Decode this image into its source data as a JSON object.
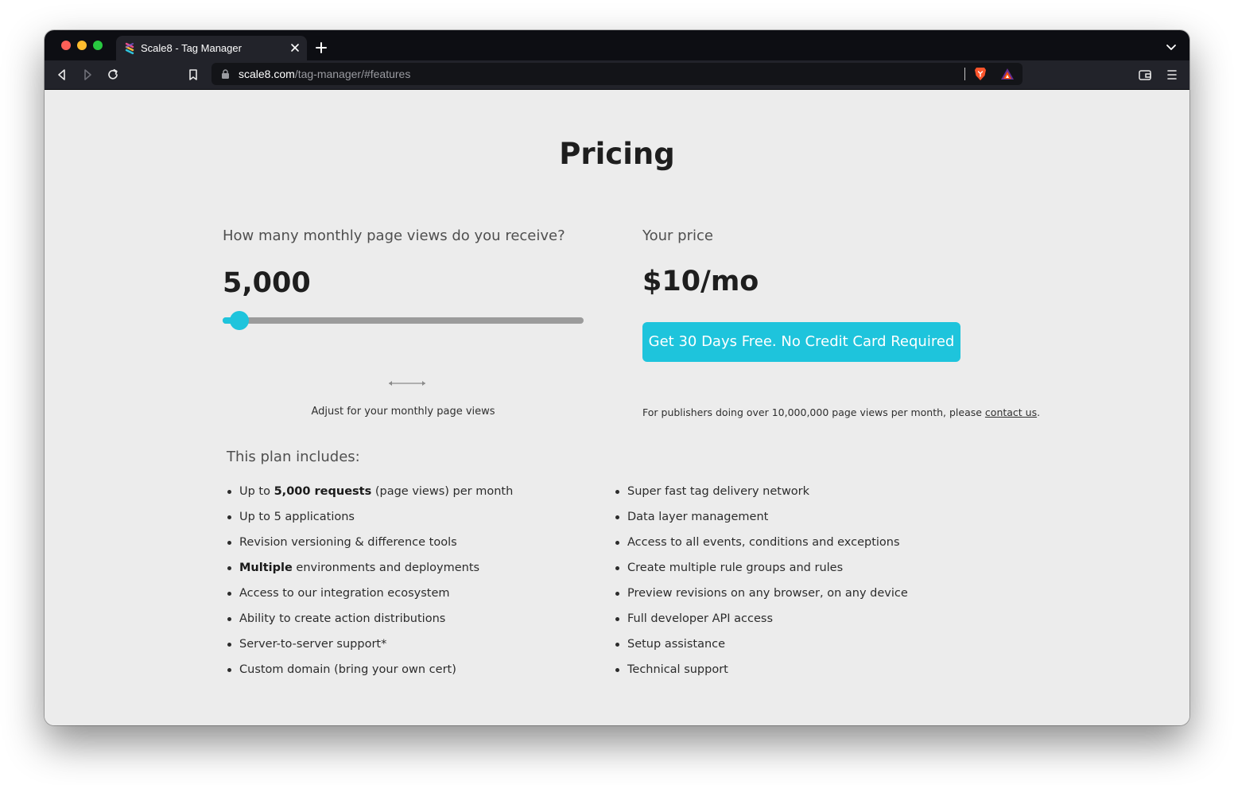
{
  "browser": {
    "tab_title": "Scale8 - Tag Manager",
    "url_host": "scale8.com",
    "url_path": "/tag-manager/#features"
  },
  "page": {
    "title": "Pricing",
    "pageviews_question": "How many monthly page views do you receive?",
    "pageviews_value": "5,000",
    "slider_fraction": 0.02,
    "slider_hint": "Adjust for your monthly page views",
    "price_label": "Your price",
    "price_value": "$10/mo",
    "cta_label": "Get 30 Days Free. No Credit Card Required",
    "publishers_text": "For publishers doing over 10,000,000 page views per month, please ",
    "contact_link": "contact us",
    "publishers_suffix": ".",
    "plan_heading": "This plan includes:",
    "features_left": [
      {
        "pre": "Up to ",
        "bold": "5,000 requests",
        "post": " (page views) per month"
      },
      {
        "pre": "Up to 5 applications",
        "bold": "",
        "post": ""
      },
      {
        "pre": "Revision versioning & difference tools",
        "bold": "",
        "post": ""
      },
      {
        "pre": "",
        "bold": "Multiple",
        "post": " environments and deployments"
      },
      {
        "pre": "Access to our integration ecosystem",
        "bold": "",
        "post": ""
      },
      {
        "pre": "Ability to create action distributions",
        "bold": "",
        "post": ""
      },
      {
        "pre": "Server-to-server support*",
        "bold": "",
        "post": ""
      },
      {
        "pre": "Custom domain (bring your own cert)",
        "bold": "",
        "post": ""
      }
    ],
    "features_right": [
      "Super fast tag delivery network",
      "Data layer management",
      "Access to all events, conditions and exceptions",
      "Create multiple rule groups and rules",
      "Preview revisions on any browser, on any device",
      "Full developer API access",
      "Setup assistance",
      "Technical support"
    ]
  },
  "colors": {
    "accent": "#1ec4dc",
    "page_background": "#ececec",
    "browser_chrome": "#22232a"
  }
}
